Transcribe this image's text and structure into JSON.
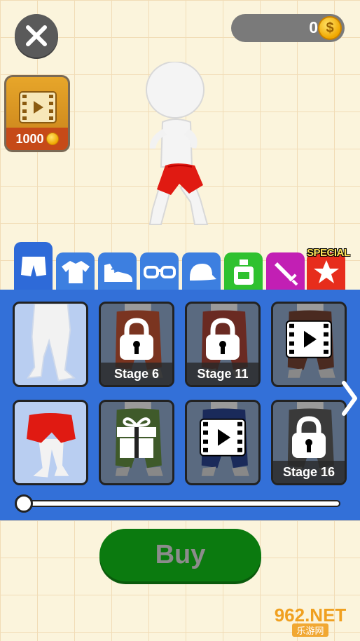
{
  "header": {
    "close_icon": "close-x-icon",
    "coin_count": "0",
    "coin_symbol": "$"
  },
  "video_reward": {
    "icon": "video-film-icon",
    "price": "1000"
  },
  "tabs": [
    {
      "name": "shorts",
      "icon": "shorts-icon",
      "active": true
    },
    {
      "name": "shirt",
      "icon": "shirt-icon"
    },
    {
      "name": "shoe",
      "icon": "sneaker-icon"
    },
    {
      "name": "glasses",
      "icon": "glasses-icon"
    },
    {
      "name": "cap",
      "icon": "cap-icon"
    },
    {
      "name": "bottle",
      "icon": "perfume-bottle-icon",
      "color": "#2fc12f"
    },
    {
      "name": "sword",
      "icon": "sword-icon",
      "color": "#c21fb4"
    },
    {
      "name": "special",
      "icon": "star-icon",
      "color": "#e72d1c"
    }
  ],
  "special_label": "SPECIAL",
  "items": [
    {
      "kind": "owned-plain",
      "label": ""
    },
    {
      "kind": "locked",
      "label": "Stage 6"
    },
    {
      "kind": "locked",
      "label": "Stage 11"
    },
    {
      "kind": "video",
      "label": ""
    },
    {
      "kind": "owned-red",
      "label": ""
    },
    {
      "kind": "gift",
      "label": ""
    },
    {
      "kind": "video",
      "label": ""
    },
    {
      "kind": "locked",
      "label": "Stage 16"
    }
  ],
  "slider": {
    "position": 0.0
  },
  "buy_button": {
    "label": "Buy"
  },
  "watermark": {
    "top": "962.NET",
    "bottom": "乐游网"
  },
  "colors": {
    "background": "#fbf4dc",
    "panel": "#3370d8",
    "buy_button": "#0b7a0f",
    "coin": "#f0a800"
  }
}
